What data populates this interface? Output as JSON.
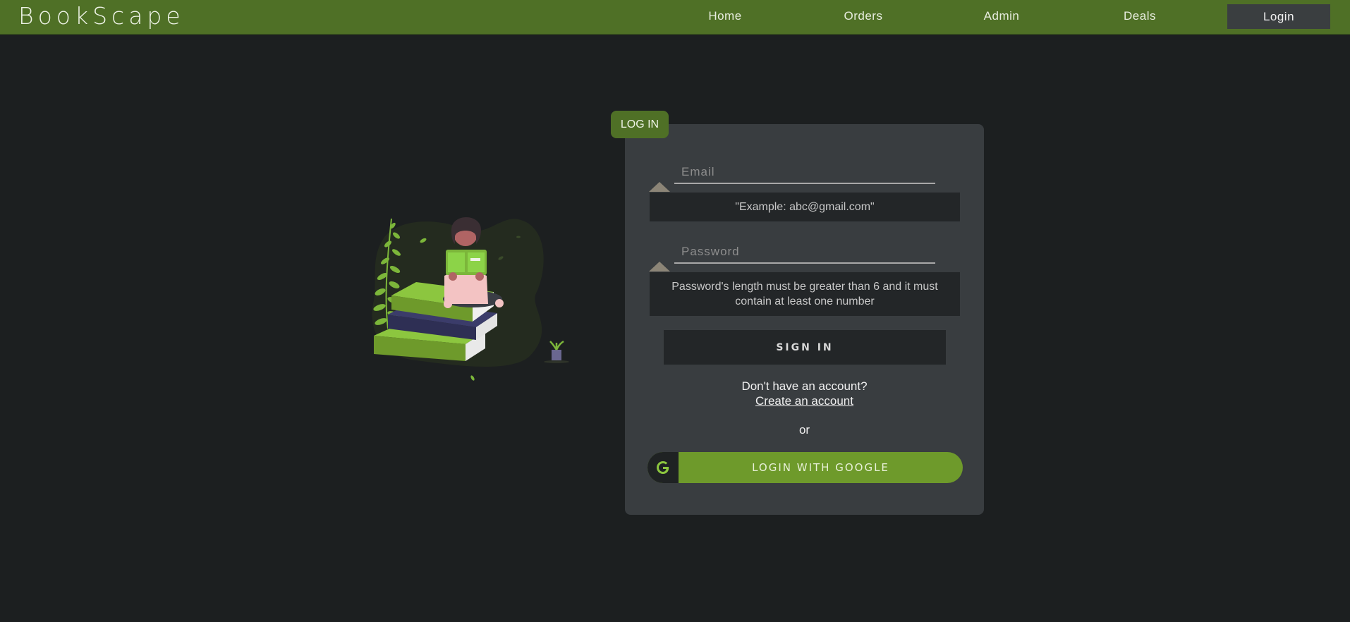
{
  "header": {
    "brand": "BookScape",
    "nav": [
      "Home",
      "Orders",
      "Admin",
      "Deals"
    ],
    "login_label": "Login"
  },
  "form": {
    "tab_label": "LOG IN",
    "email_placeholder": "Email",
    "email_hint": "\"Example: abc@gmail.com\"",
    "password_placeholder": "Password",
    "password_hint": "Password's length must be greater than 6 and it must contain at least one number",
    "signin_label": "SIGN IN",
    "no_account_text": "Don't have an account?",
    "create_account_link": "Create an account",
    "or_text": "or",
    "google_label": "LOGIN WITH GOOGLE"
  },
  "colors": {
    "accent": "#4f7026",
    "google_button": "#6e9a2b",
    "card": "#393d40",
    "background": "#1c1f20"
  }
}
